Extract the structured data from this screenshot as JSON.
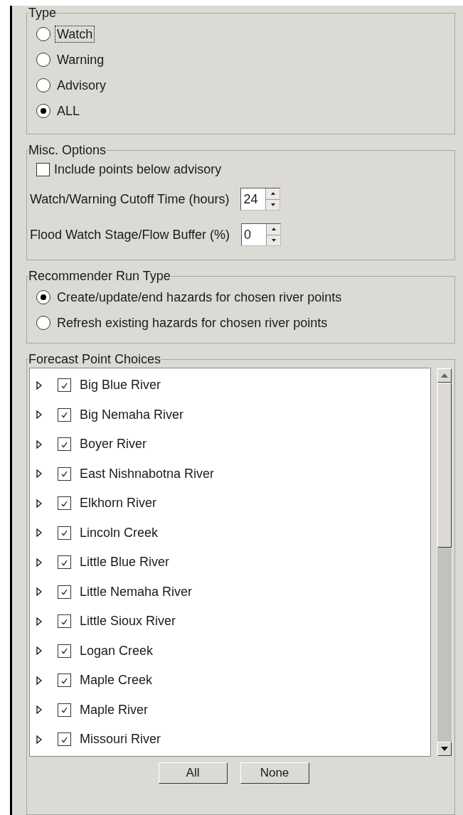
{
  "type_group": {
    "legend": "Type",
    "options": [
      {
        "label": "Watch",
        "selected": false,
        "focused": true
      },
      {
        "label": "Warning",
        "selected": false,
        "focused": false
      },
      {
        "label": "Advisory",
        "selected": false,
        "focused": false
      },
      {
        "label": "ALL",
        "selected": true,
        "focused": false
      }
    ]
  },
  "misc_options": {
    "legend": "Misc. Options",
    "checkbox": {
      "label": "Include points below advisory",
      "checked": false
    },
    "spinners": [
      {
        "label": "Watch/Warning Cutoff Time (hours)",
        "value": "24"
      },
      {
        "label": "Flood Watch Stage/Flow Buffer (%)",
        "value": "0"
      }
    ]
  },
  "run_type": {
    "legend": "Recommender Run Type",
    "options": [
      {
        "label": "Create/update/end hazards for chosen river points",
        "selected": true
      },
      {
        "label": "Refresh existing hazards for chosen river points",
        "selected": false
      }
    ]
  },
  "forecast_points": {
    "legend": "Forecast Point Choices",
    "items": [
      {
        "label": "Big Blue River",
        "checked": true,
        "expanded": false
      },
      {
        "label": "Big Nemaha River",
        "checked": true,
        "expanded": false
      },
      {
        "label": "Boyer River",
        "checked": true,
        "expanded": false
      },
      {
        "label": "East Nishnabotna River",
        "checked": true,
        "expanded": false
      },
      {
        "label": "Elkhorn River",
        "checked": true,
        "expanded": false
      },
      {
        "label": "Lincoln Creek",
        "checked": true,
        "expanded": false
      },
      {
        "label": "Little Blue River",
        "checked": true,
        "expanded": false
      },
      {
        "label": "Little Nemaha River",
        "checked": true,
        "expanded": false
      },
      {
        "label": "Little Sioux River",
        "checked": true,
        "expanded": false
      },
      {
        "label": "Logan Creek",
        "checked": true,
        "expanded": false
      },
      {
        "label": "Maple Creek",
        "checked": true,
        "expanded": false
      },
      {
        "label": "Maple River",
        "checked": true,
        "expanded": false
      },
      {
        "label": "Missouri River",
        "checked": true,
        "expanded": false
      }
    ],
    "buttons": [
      "All",
      "None"
    ]
  }
}
